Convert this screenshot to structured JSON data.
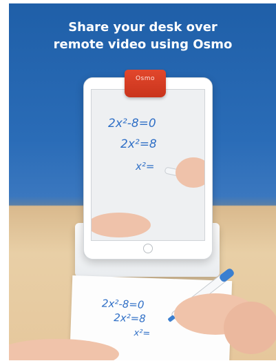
{
  "headline": {
    "line1": "Share your desk over",
    "line2": "remote video using Osmo"
  },
  "device": {
    "clip_label": "Osmo"
  },
  "screen_math": {
    "line1": "2x²-8=0",
    "line2": "2x²=8",
    "line3": "x²="
  },
  "paper_math": {
    "line1": "2x²-8=0",
    "line2": "2x²=8",
    "line3": "x²="
  },
  "colors": {
    "background_top": "#1f5fa8",
    "desk": "#e6c79c",
    "clip": "#d63b22",
    "ink": "#2f6fc6"
  }
}
